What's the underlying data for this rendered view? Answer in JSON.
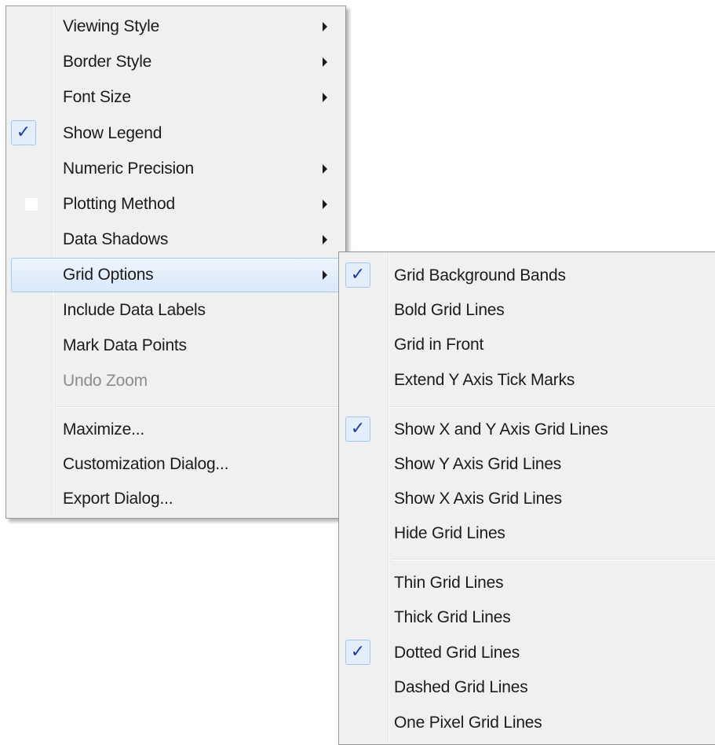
{
  "main_menu": {
    "items": [
      {
        "label": "Viewing Style",
        "submenu": true
      },
      {
        "label": "Border Style",
        "submenu": true
      },
      {
        "label": "Font Size",
        "submenu": true
      },
      {
        "label": "Show Legend",
        "checked": true
      },
      {
        "label": "Numeric Precision",
        "submenu": true
      },
      {
        "label": "Plotting Method",
        "submenu": true
      },
      {
        "label": "Data Shadows",
        "submenu": true
      },
      {
        "label": "Grid Options",
        "submenu": true,
        "highlighted": true
      },
      {
        "label": "Include Data Labels"
      },
      {
        "label": "Mark Data Points"
      },
      {
        "label": "Undo Zoom",
        "disabled": true
      },
      {
        "label": "Maximize..."
      },
      {
        "label": "Customization Dialog..."
      },
      {
        "label": "Export Dialog..."
      }
    ]
  },
  "grid_submenu": {
    "items": [
      {
        "label": "Grid Background Bands",
        "checked": true
      },
      {
        "label": "Bold Grid Lines"
      },
      {
        "label": "Grid in Front"
      },
      {
        "label": "Extend Y Axis Tick Marks"
      },
      {
        "label": "Show X and Y Axis Grid Lines",
        "checked": true
      },
      {
        "label": "Show Y Axis Grid Lines"
      },
      {
        "label": "Show X Axis Grid Lines"
      },
      {
        "label": "Hide Grid Lines"
      },
      {
        "label": "Thin Grid Lines"
      },
      {
        "label": "Thick Grid Lines"
      },
      {
        "label": "Dotted Grid Lines",
        "checked": true
      },
      {
        "label": "Dashed Grid Lines"
      },
      {
        "label": "One Pixel Grid Lines"
      }
    ]
  },
  "check_glyph": "✓",
  "colors": {
    "menu_bg": "#f0f0f0",
    "highlight_border": "#a9cbf2",
    "check_color": "#1e3f9c",
    "disabled_text": "#8d8d8d"
  }
}
